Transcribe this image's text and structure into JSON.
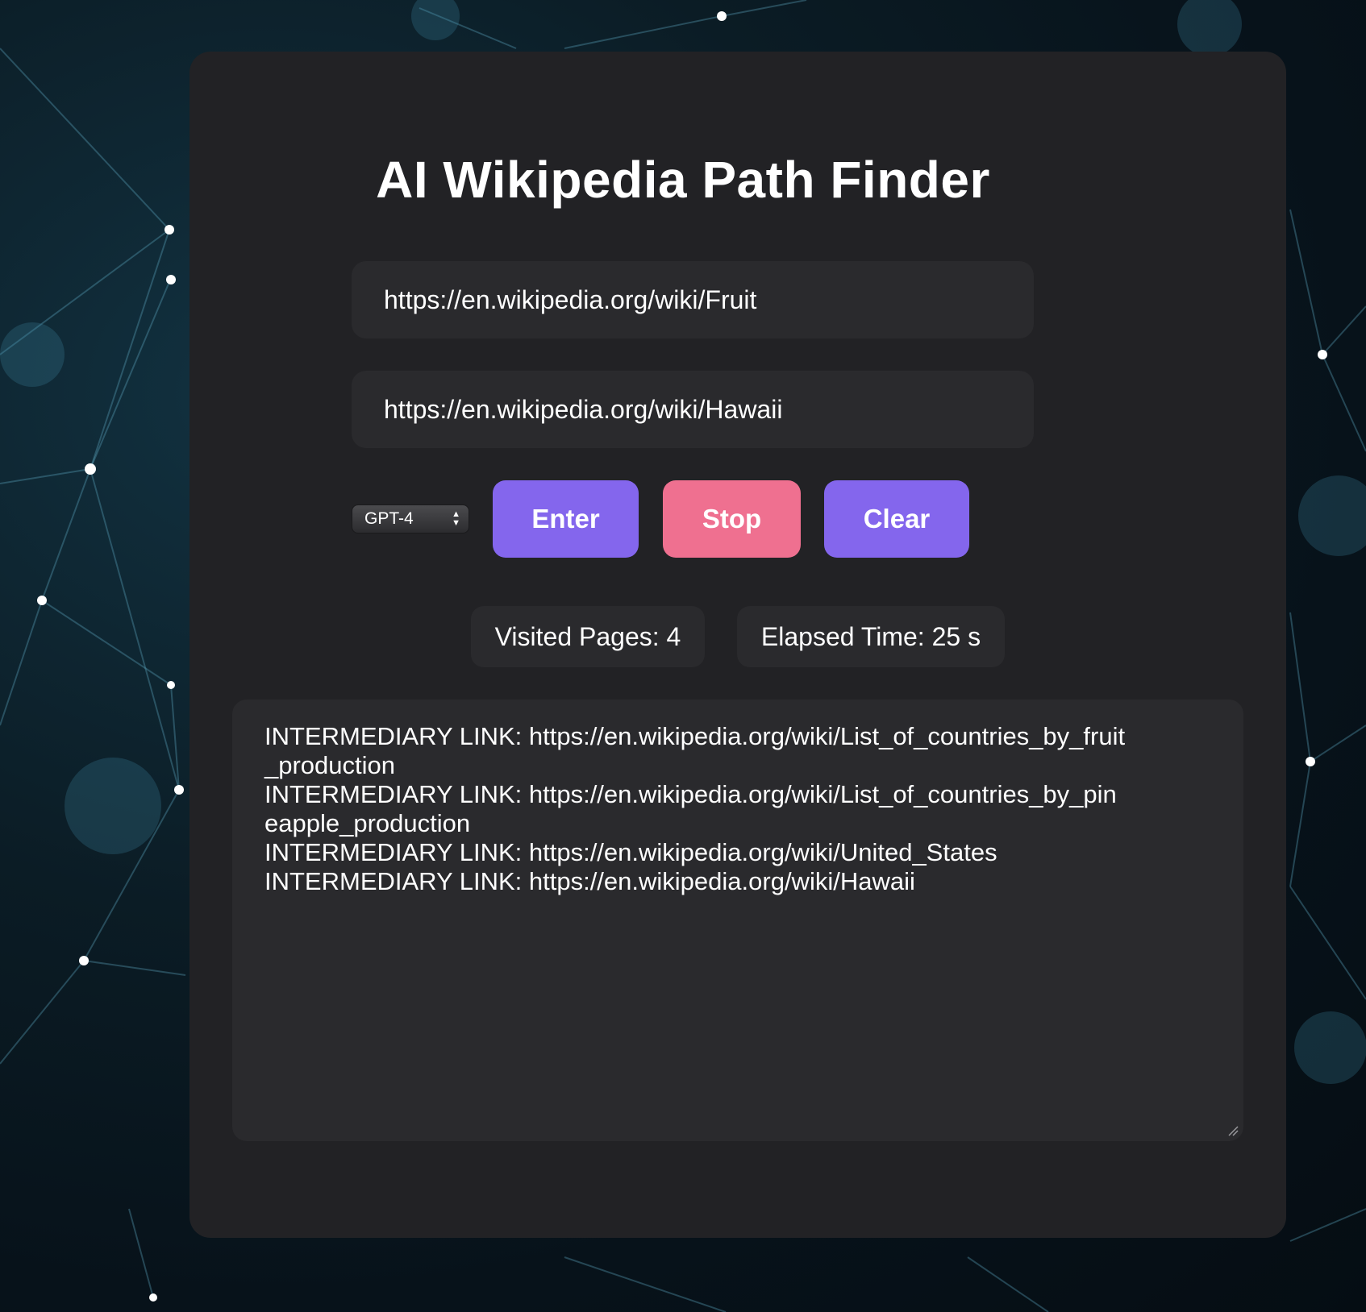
{
  "app": {
    "title": "AI Wikipedia Path Finder"
  },
  "inputs": {
    "start_url": "https://en.wikipedia.org/wiki/Fruit",
    "target_url": "https://en.wikipedia.org/wiki/Hawaii"
  },
  "controls": {
    "model_selected": "GPT-4",
    "enter_label": "Enter",
    "stop_label": "Stop",
    "clear_label": "Clear"
  },
  "stats": {
    "visited_pages": "Visited Pages: 4",
    "elapsed_time": "Elapsed Time: 25 s"
  },
  "output": {
    "lines": [
      "INTERMEDIARY LINK: https://en.wikipedia.org/wiki/List_of_countries_by_fruit_production",
      "INTERMEDIARY LINK: https://en.wikipedia.org/wiki/List_of_countries_by_pineapple_production",
      "INTERMEDIARY LINK: https://en.wikipedia.org/wiki/United_States",
      "INTERMEDIARY LINK: https://en.wikipedia.org/wiki/Hawaii"
    ]
  },
  "colors": {
    "panel": "#222225",
    "field": "#2a2a2d",
    "accent_purple": "#8466ed",
    "accent_pink": "#ef7090"
  },
  "icons": {
    "select_chevron": "up-down-chevron-icon",
    "resize": "resize-handle-icon"
  }
}
